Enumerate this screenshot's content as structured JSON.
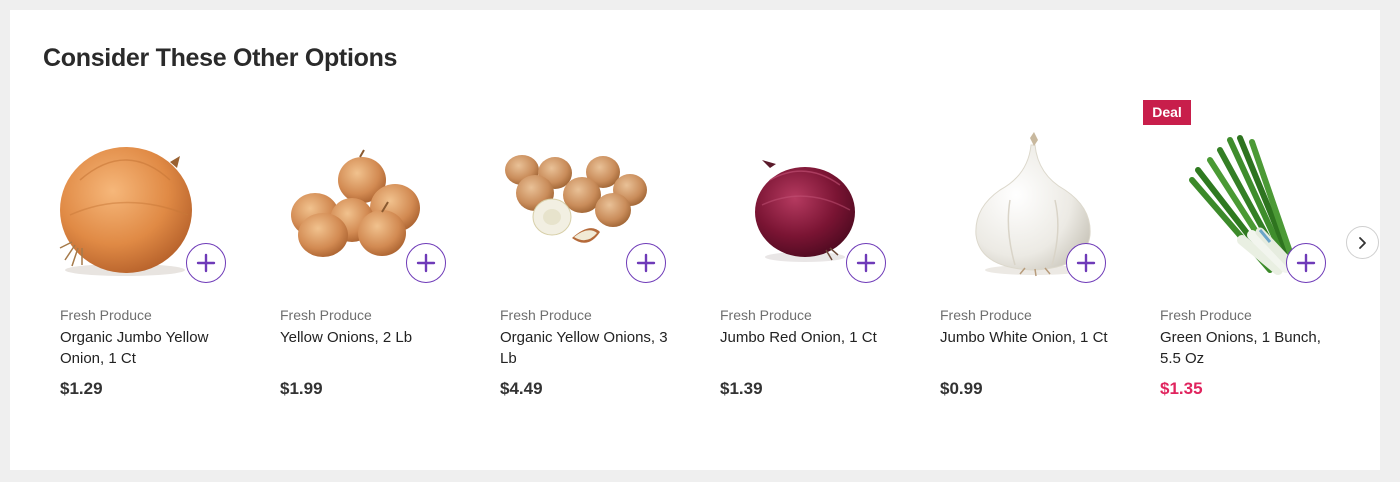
{
  "section": {
    "title": "Consider These Other Options"
  },
  "products": [
    {
      "category": "Fresh Produce",
      "name": "Organic Jumbo Yellow Onion, 1 Ct",
      "price": "$1.29",
      "deal": false,
      "image": "yellow-onion"
    },
    {
      "category": "Fresh Produce",
      "name": "Yellow Onions, 2 Lb",
      "price": "$1.99",
      "deal": false,
      "image": "yellow-onions-bag"
    },
    {
      "category": "Fresh Produce",
      "name": "Organic Yellow Onions, 3 Lb",
      "price": "$4.49",
      "deal": false,
      "image": "organic-yellow-onions"
    },
    {
      "category": "Fresh Produce",
      "name": "Jumbo Red Onion, 1 Ct",
      "price": "$1.39",
      "deal": false,
      "image": "red-onion"
    },
    {
      "category": "Fresh Produce",
      "name": "Jumbo White Onion, 1 Ct",
      "price": "$0.99",
      "deal": false,
      "image": "white-onion"
    },
    {
      "category": "Fresh Produce",
      "name": "Green Onions, 1 Bunch, 5.5 Oz",
      "price": "$1.35",
      "deal": true,
      "image": "green-onions"
    }
  ],
  "deal_badge": "Deal",
  "icons": {
    "add": "plus-icon",
    "next": "chevron-right-icon"
  },
  "colors": {
    "accent": "#6e3ab8",
    "deal_badge": "#c81e4b",
    "deal_price": "#e0245e"
  }
}
